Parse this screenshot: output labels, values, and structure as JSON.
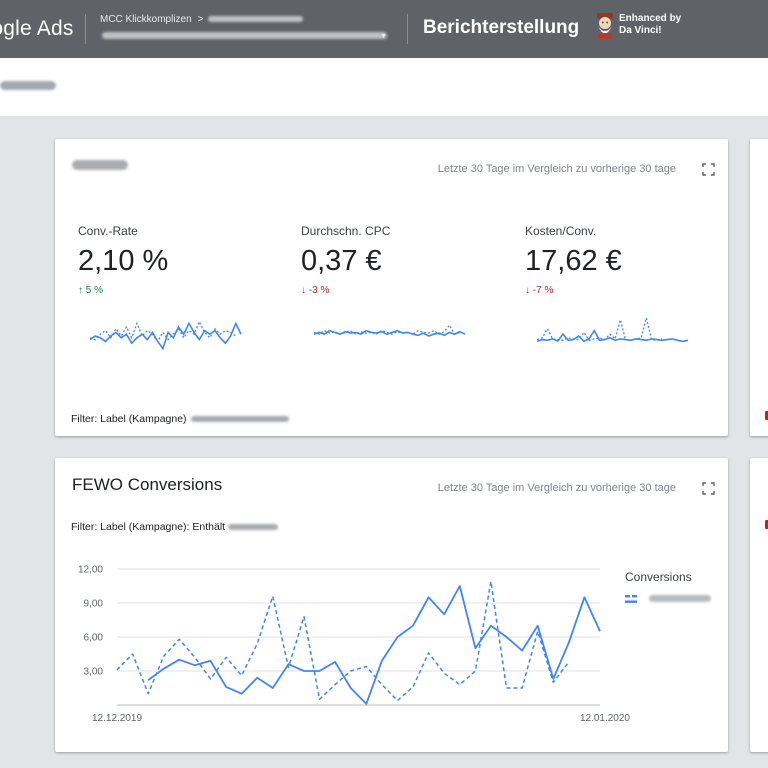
{
  "topbar": {
    "brand": "Google Ads",
    "breadcrumb_account": "MCC Klickkomplizen",
    "breadcrumb_sep": ">",
    "page_title": "Berichterstellung",
    "extension_line1": "Enhanced by",
    "extension_line2": "Da Vinci!"
  },
  "card_scorecard": {
    "date_range": "Letzte 30 Tage im Vergleich zu vorherige 30 tage",
    "metrics": [
      {
        "label": "Conv.-Rate",
        "value": "2,10 %",
        "change": "↑ 5 %",
        "direction": "up"
      },
      {
        "label": "Durchschn. CPC",
        "value": "0,37 €",
        "change": "↓ -3 %",
        "direction": "down"
      },
      {
        "label": "Kosten/Conv.",
        "value": "17,62 €",
        "change": "↓ -7 %",
        "direction": "down"
      }
    ],
    "filter": "Filter: Label (Kampagne)"
  },
  "card_chart": {
    "title": "FEWO Conversions",
    "date_range": "Letzte 30 Tage im Vergleich zu vorherige 30 tage",
    "filter": "Filter: Label (Kampagne): Enthält",
    "legend_title": "Conversions"
  },
  "colors": {
    "accent": "#4285f4",
    "positive": "#188038",
    "negative": "#c5221f",
    "topbar": "#5f6368"
  },
  "chart_data": {
    "type": "line",
    "x": [
      "12.12.2019",
      "13.12.2019",
      "14.12.2019",
      "15.12.2019",
      "16.12.2019",
      "17.12.2019",
      "18.12.2019",
      "19.12.2019",
      "20.12.2019",
      "21.12.2019",
      "22.12.2019",
      "23.12.2019",
      "24.12.2019",
      "25.12.2019",
      "26.12.2019",
      "27.12.2019",
      "28.12.2019",
      "29.12.2019",
      "30.12.2019",
      "31.12.2019",
      "01.01.2020",
      "02.01.2020",
      "03.01.2020",
      "04.01.2020",
      "05.01.2020",
      "06.01.2020",
      "07.01.2020",
      "08.01.2020",
      "09.01.2020",
      "10.01.2020",
      "11.01.2020",
      "12.01.2020"
    ],
    "x_tick_labels": [
      "12.12.2019",
      "12.01.2020"
    ],
    "series": [
      {
        "style": "solid",
        "values": [
          null,
          null,
          2.2,
          3.2,
          4.0,
          3.5,
          3.9,
          1.6,
          1.0,
          2.4,
          1.5,
          3.6,
          3.0,
          3.0,
          3.8,
          1.5,
          0.1,
          3.9,
          6.0,
          7.0,
          9.5,
          8.0,
          10.5,
          5.0,
          7.0,
          6.0,
          4.8,
          7.0,
          2.3,
          5.5,
          9.5,
          6.5
        ]
      },
      {
        "style": "dotted",
        "values": [
          3.1,
          4.5,
          1.0,
          4.3,
          5.8,
          4.2,
          2.3,
          4.2,
          2.6,
          5.4,
          9.6,
          3.3,
          7.8,
          0.5,
          1.8,
          3.0,
          3.4,
          1.8,
          0.4,
          1.6,
          4.6,
          2.8,
          1.8,
          3.0,
          10.9,
          1.5,
          1.5,
          6.5,
          2.0,
          3.8,
          null,
          null
        ]
      }
    ],
    "y_ticks": [
      "3,00",
      "6,00",
      "9,00",
      "12,00"
    ],
    "ylim": [
      0,
      12
    ],
    "grid": true,
    "legend_position": "right"
  },
  "sparklines": [
    {
      "solid": [
        0.4,
        0.5,
        0.45,
        0.35,
        0.5,
        0.6,
        0.45,
        0.55,
        0.3,
        0.45,
        0.55,
        0.4,
        0.6,
        0.35,
        0.15,
        0.6,
        0.45,
        0.75,
        0.55,
        0.85,
        0.6,
        0.4,
        0.65,
        0.55,
        0.65,
        0.45,
        0.3,
        0.5,
        0.85,
        0.55
      ],
      "dotted": [
        0.45,
        0.4,
        0.55,
        0.65,
        0.45,
        0.7,
        0.5,
        0.75,
        0.45,
        0.85,
        0.5,
        0.65,
        0.55,
        0.35,
        0.6,
        0.4,
        0.55,
        0.7,
        0.45,
        0.65,
        0.55,
        0.9,
        0.6,
        0.45,
        0.7,
        0.55,
        0.65,
        0.6,
        0.5,
        null
      ]
    },
    {
      "solid": [
        0.55,
        0.6,
        0.55,
        0.65,
        0.6,
        0.55,
        0.62,
        0.58,
        0.6,
        0.55,
        0.65,
        0.6,
        0.58,
        0.62,
        0.55,
        0.6,
        0.65,
        0.58,
        0.6,
        0.55,
        0.52,
        0.58,
        0.5,
        0.55,
        0.58,
        0.52,
        0.6,
        0.55,
        0.62,
        0.55
      ],
      "dotted": [
        0.6,
        0.55,
        0.65,
        0.58,
        0.62,
        0.55,
        0.6,
        0.65,
        0.55,
        0.62,
        0.58,
        0.6,
        0.55,
        0.65,
        0.6,
        0.55,
        0.62,
        0.58,
        0.6,
        0.55,
        0.65,
        0.6,
        0.58,
        0.65,
        0.55,
        0.62,
        0.8,
        0.55,
        0.6,
        null
      ]
    },
    {
      "solid": [
        0.35,
        0.4,
        0.38,
        0.42,
        0.36,
        0.55,
        0.38,
        0.4,
        0.5,
        0.35,
        0.42,
        0.65,
        0.38,
        0.4,
        0.45,
        0.38,
        0.42,
        0.4,
        0.38,
        0.42,
        0.4,
        0.38,
        0.42,
        0.4,
        0.38,
        0.4,
        0.42,
        0.38,
        0.35,
        0.38
      ],
      "dotted": [
        0.4,
        0.45,
        0.7,
        0.42,
        0.4,
        0.38,
        0.45,
        0.42,
        0.4,
        0.6,
        0.38,
        0.42,
        0.45,
        0.4,
        0.55,
        0.42,
        0.95,
        0.4,
        0.38,
        0.42,
        0.45,
        1.0,
        0.4,
        0.38,
        0.42,
        null,
        null,
        null,
        null,
        null
      ]
    }
  ]
}
